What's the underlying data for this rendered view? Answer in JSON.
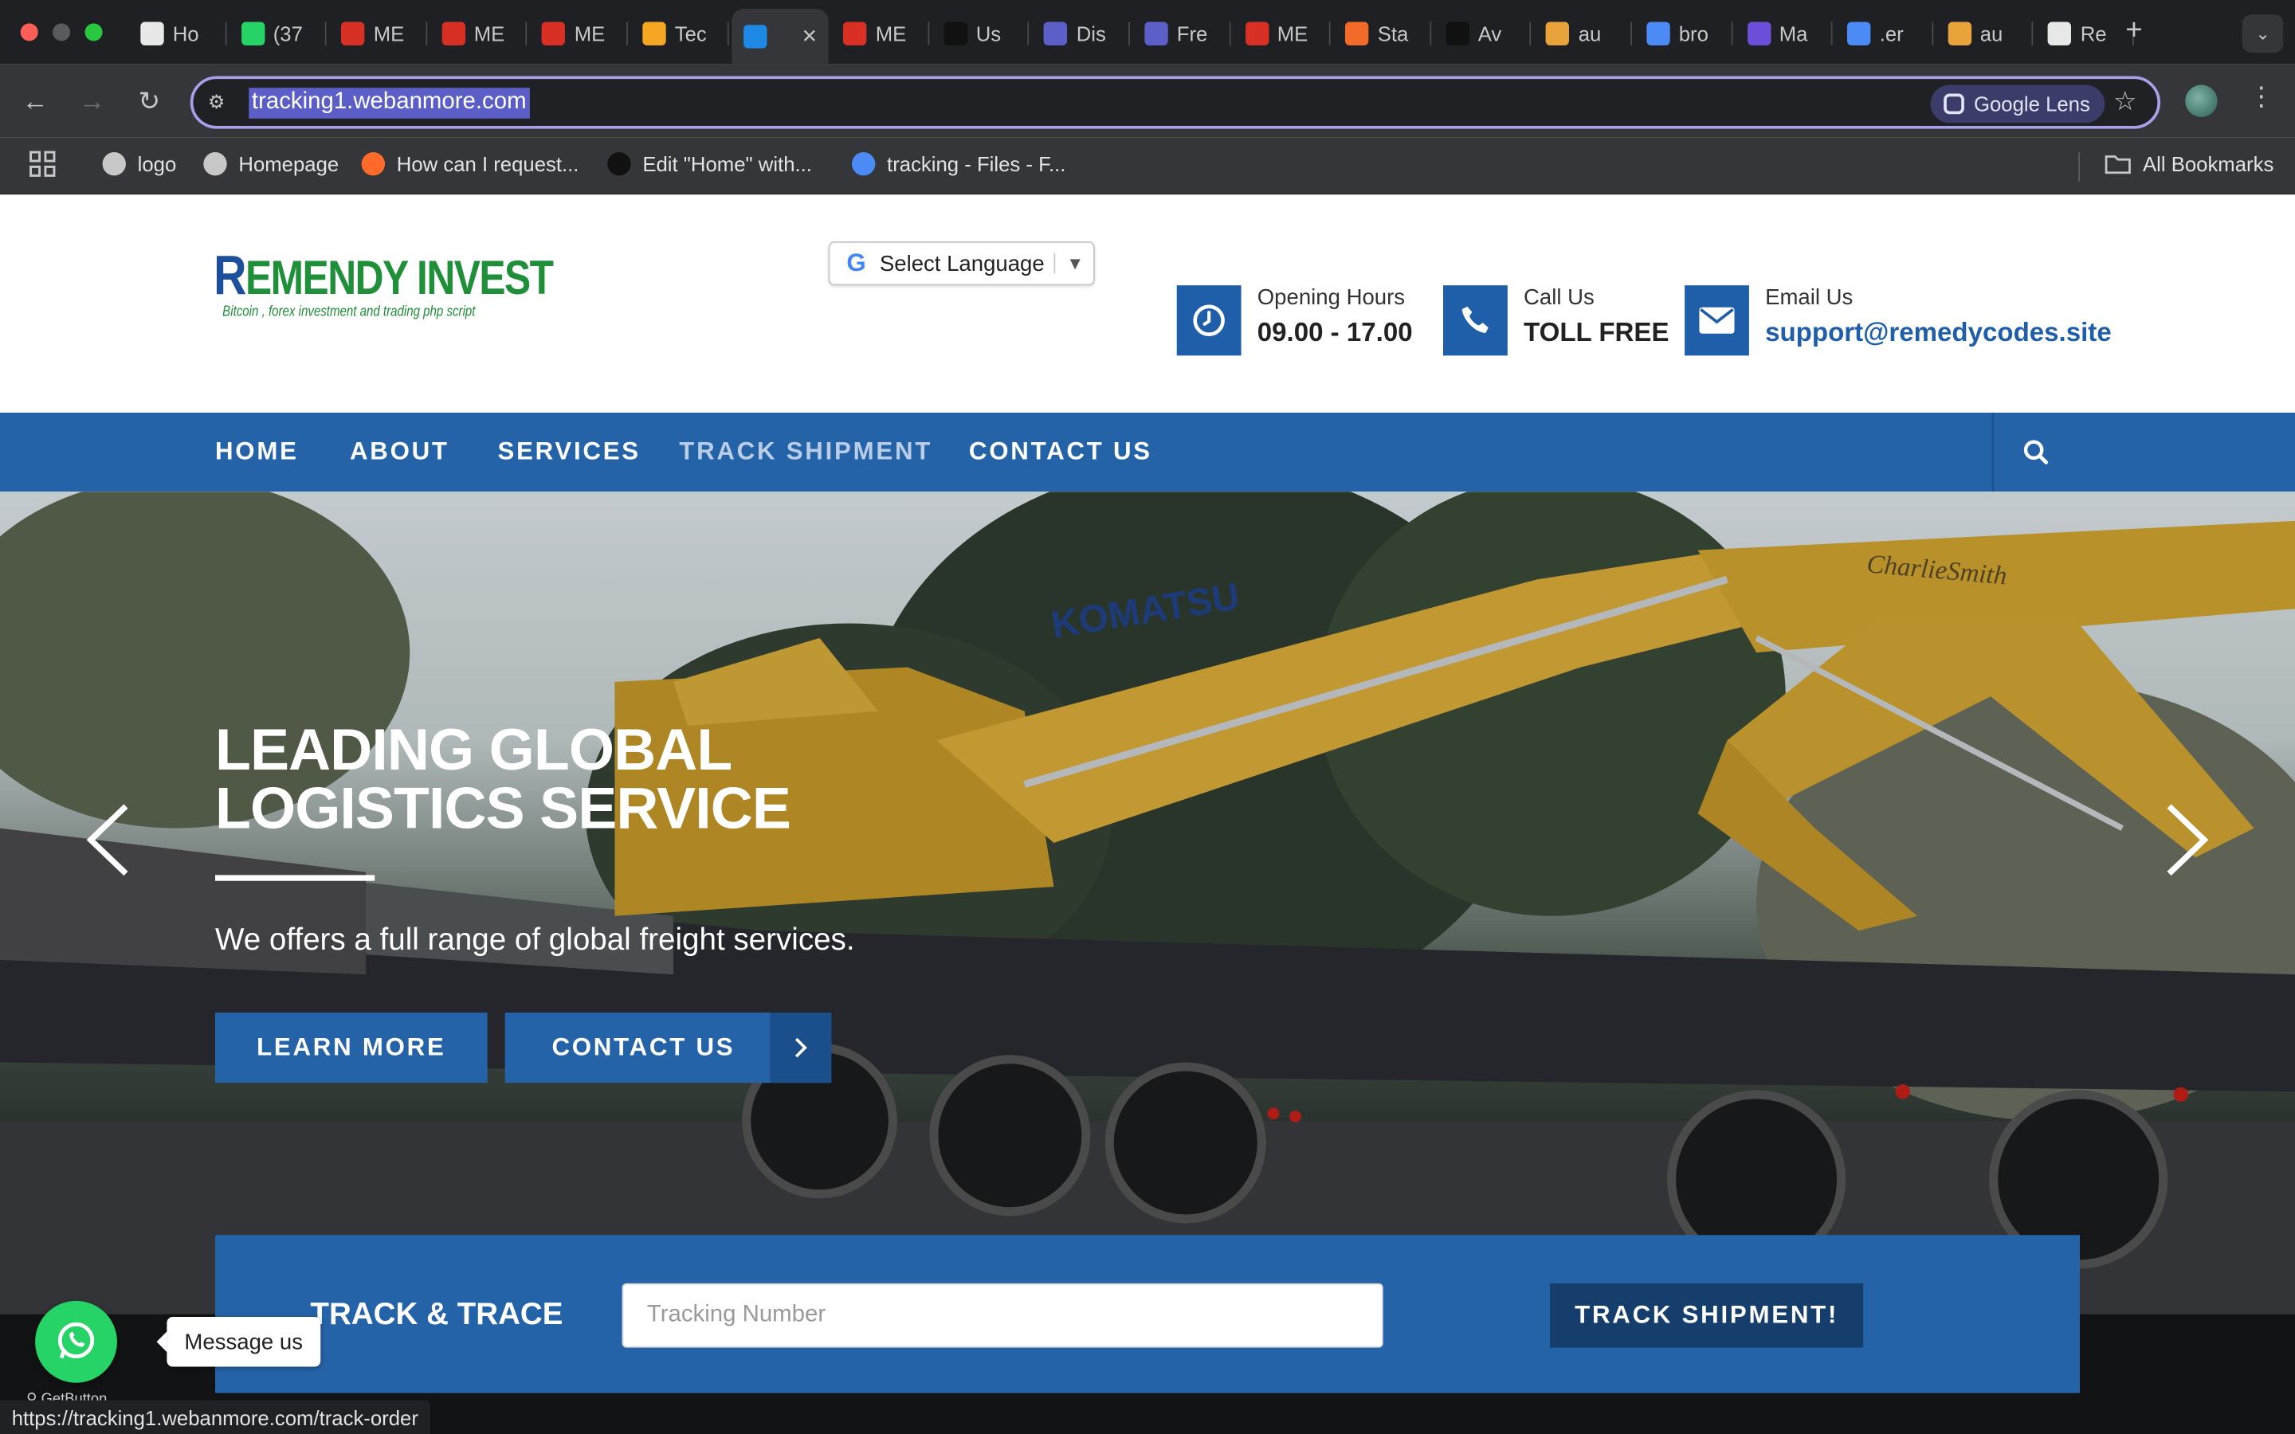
{
  "browser": {
    "tabs": [
      {
        "label": "Ho",
        "icon": "youtube-icon",
        "color": "#e8e8e8"
      },
      {
        "label": "(37",
        "icon": "whatsapp-icon",
        "color": "#25d366"
      },
      {
        "label": "ME",
        "icon": "gmail-icon",
        "color": "#d93025"
      },
      {
        "label": "ME",
        "icon": "gmail-icon",
        "color": "#d93025"
      },
      {
        "label": "ME",
        "icon": "gmail-icon",
        "color": "#d93025"
      },
      {
        "label": "Tec",
        "icon": "site-icon",
        "color": "#f5a623"
      },
      {
        "label": "",
        "icon": "p-logo-icon",
        "color": "#1e88e5"
      },
      {
        "label": "ME",
        "icon": "gmail-icon",
        "color": "#d93025"
      },
      {
        "label": "Us",
        "icon": "a-logo-icon",
        "color": "#111111"
      },
      {
        "label": "Dis",
        "icon": "c-logo-icon",
        "color": "#5b5fc7"
      },
      {
        "label": "Fre",
        "icon": "c-logo-icon",
        "color": "#5b5fc7"
      },
      {
        "label": "ME",
        "icon": "gmail-icon",
        "color": "#d93025"
      },
      {
        "label": "Sta",
        "icon": "flag-icon",
        "color": "#f26b2a"
      },
      {
        "label": "Av",
        "icon": "s-logo-icon",
        "color": "#111111"
      },
      {
        "label": "au",
        "icon": "m-logo-icon",
        "color": "#e8a33a"
      },
      {
        "label": "bro",
        "icon": "bot-icon",
        "color": "#4c8bf5"
      },
      {
        "label": "Ma",
        "icon": "h-logo-icon",
        "color": "#6b4fd8"
      },
      {
        "label": ".er",
        "icon": "bot-icon",
        "color": "#4c8bf5"
      },
      {
        "label": "au",
        "icon": "m-logo-icon",
        "color": "#e8a33a"
      },
      {
        "label": "Re",
        "icon": "openai-icon",
        "color": "#e8e8e8"
      }
    ],
    "url": "tracking1.webanmore.com",
    "lens_label": "Google Lens",
    "bookmarks": [
      {
        "label": "logo",
        "icon": "globe-icon"
      },
      {
        "label": "Homepage",
        "icon": "globe-icon"
      },
      {
        "label": "How can I request...",
        "icon": "n-logo-icon"
      },
      {
        "label": "Edit \"Home\" with...",
        "icon": "a-logo-icon"
      },
      {
        "label": "tracking - Files - F...",
        "icon": "bot-icon"
      }
    ],
    "all_bookmarks": "All Bookmarks",
    "status_url": "https://tracking1.webanmore.com/track-order"
  },
  "site": {
    "logo": {
      "text": "EMENDY INVEST",
      "first_letter": "R",
      "tagline": "Bitcoin , forex investment and trading php script"
    },
    "language": {
      "label": "Select Language"
    },
    "info": [
      {
        "label": "Opening Hours",
        "value": "09.00 - 17.00",
        "icon": "clock-icon"
      },
      {
        "label": "Call Us",
        "value": "TOLL FREE",
        "icon": "phone-icon"
      },
      {
        "label": "Email Us",
        "value": "support@remedycodes.site",
        "icon": "envelope-icon"
      }
    ],
    "nav": [
      "HOME",
      "ABOUT",
      "SERVICES",
      "TRACK SHIPMENT",
      "CONTACT US"
    ],
    "hero": {
      "title_line1": "LEADING GLOBAL",
      "title_line2": "LOGISTICS SERVICE",
      "subtitle": "We offers a full range of global freight services.",
      "learn_more": "LEARN MORE",
      "contact_us": "CONTACT US",
      "excavator_brand": "KOMATSU",
      "excavator_signature": "CharlieSmith"
    },
    "track": {
      "title": "TRACK & TRACE",
      "placeholder": "Tracking Number",
      "button": "TRACK SHIPMENT!"
    },
    "whatsapp": {
      "message": "Message us",
      "credit": "GetButton"
    }
  },
  "colors": {
    "primary": "#2563a8",
    "dark_button": "#163e6d",
    "logo_green": "#1f8f3a",
    "whatsapp": "#25d366"
  }
}
